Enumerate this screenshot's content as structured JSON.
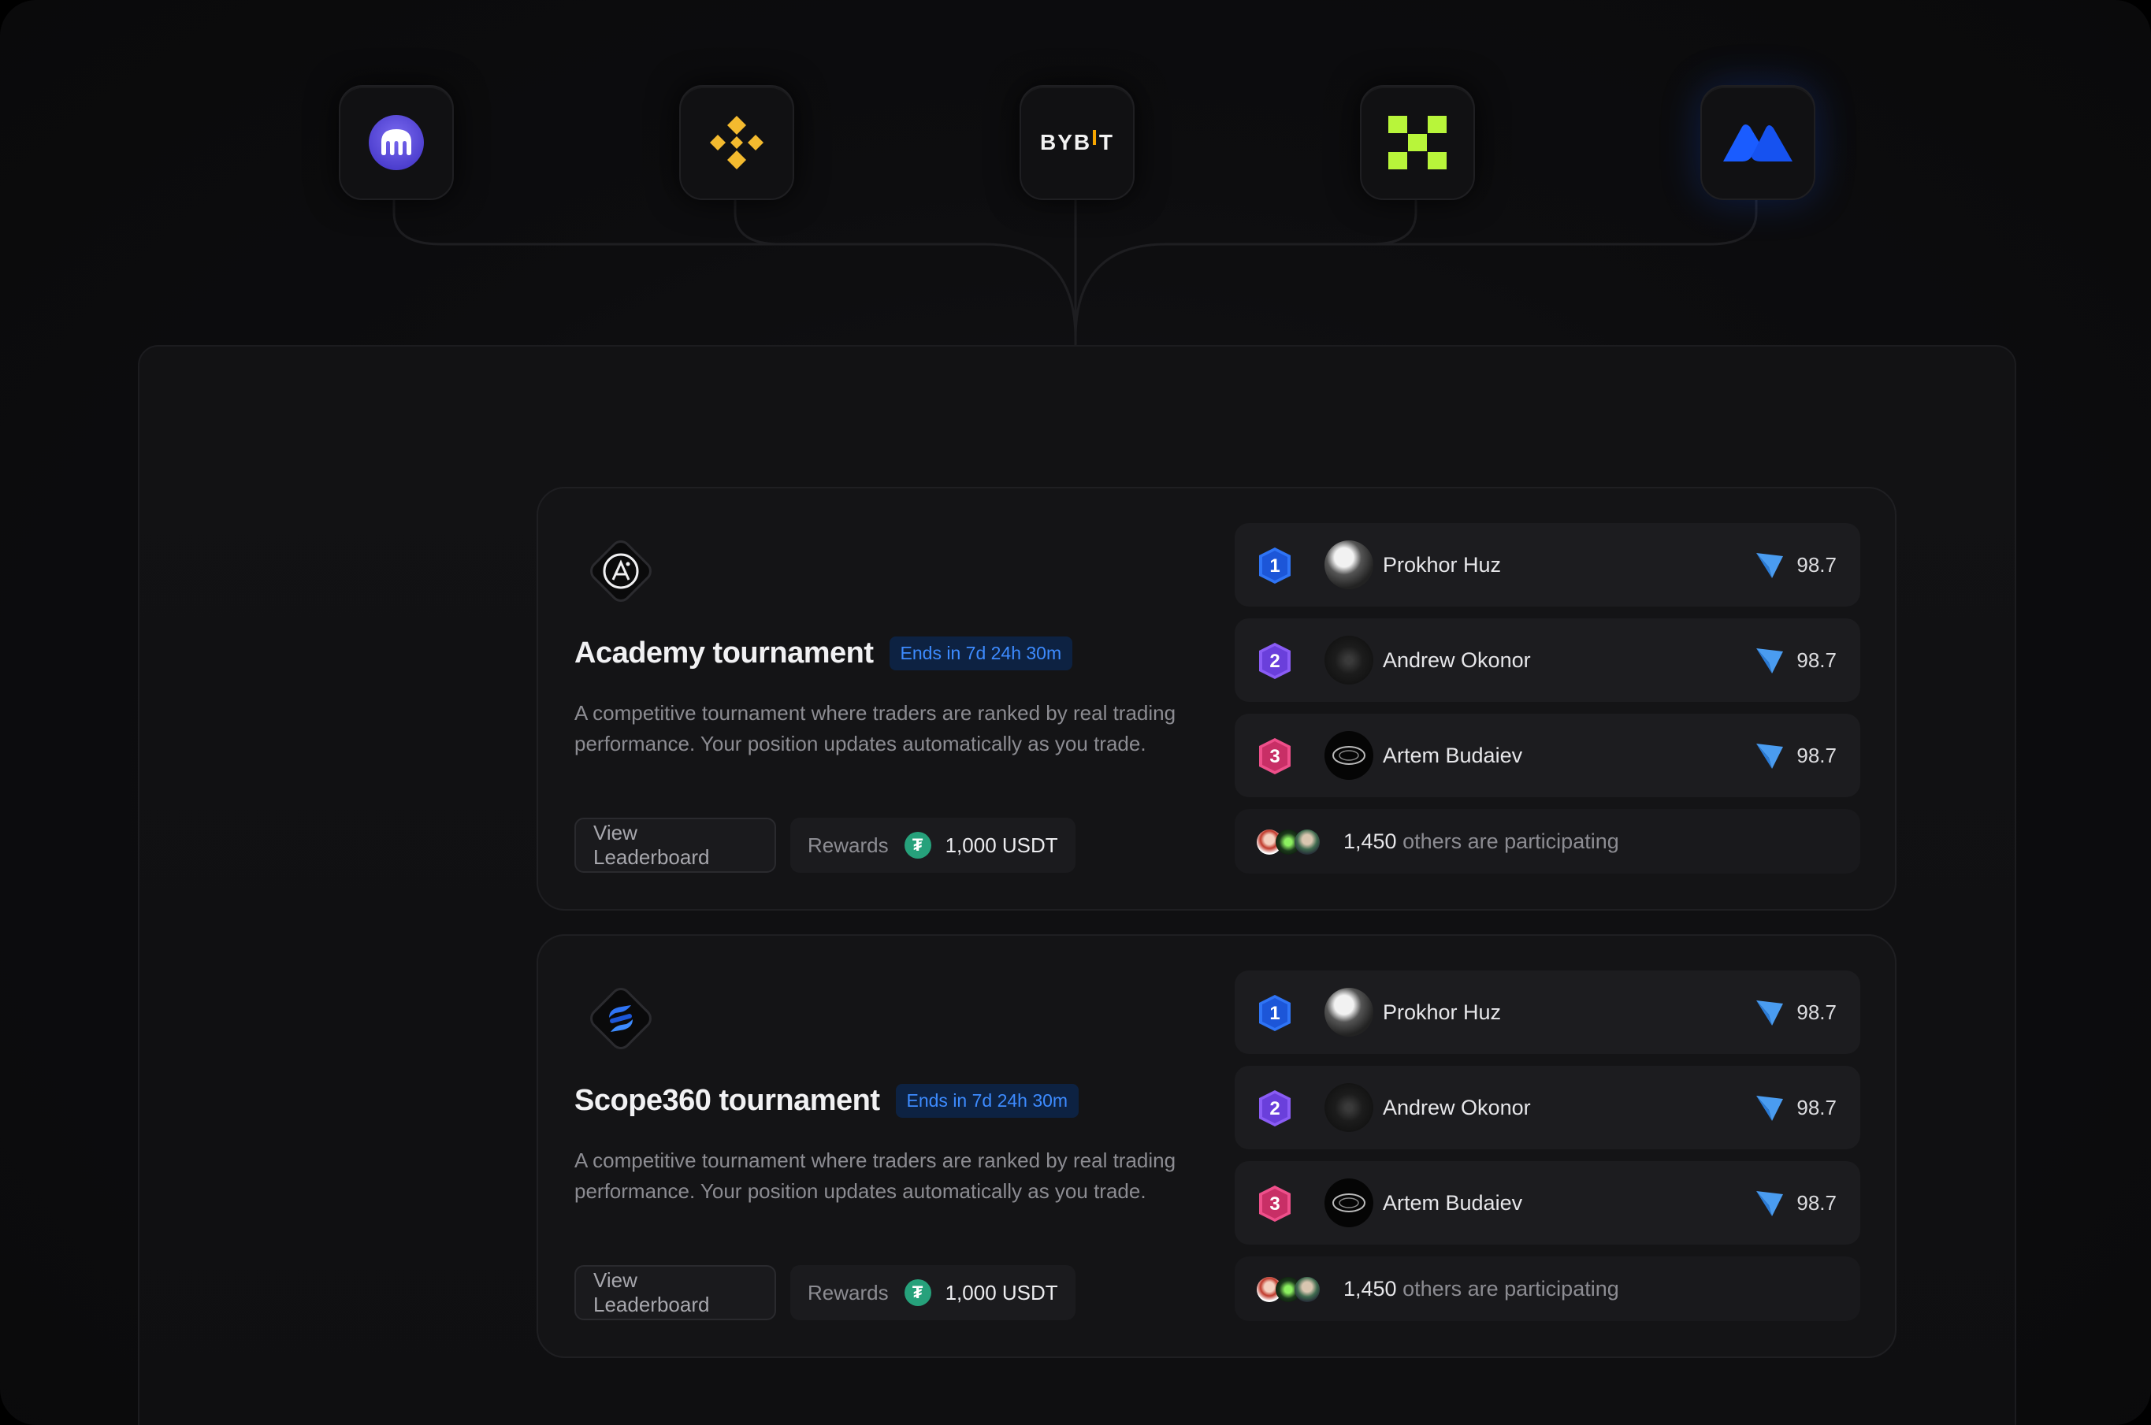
{
  "exchanges": [
    {
      "name": "Kraken",
      "icon": "kraken-logo-icon",
      "color": "#5741d9"
    },
    {
      "name": "Binance",
      "icon": "binance-logo-icon",
      "color": "#f3ba2f"
    },
    {
      "name": "Bybit",
      "icon": "bybit-logo-icon",
      "label": "BYBIT",
      "color": "#f7a600"
    },
    {
      "name": "OKX",
      "icon": "okx-logo-icon",
      "color": "#b8f53a"
    },
    {
      "name": "MEXC",
      "icon": "mexc-logo-icon",
      "color": "#1652f0"
    }
  ],
  "tournaments": [
    {
      "title": "Academy tournament",
      "icon": "academy-logo-icon",
      "ends": "Ends in 7d 24h 30m",
      "description": "A competitive tournament where traders are ranked by real trading performance. Your position updates automatically as you trade.",
      "view_label": "View Leaderboard",
      "rewards_label": "Rewards",
      "rewards_amount": "1,000 USDT",
      "leaders": [
        {
          "rank": "1",
          "name": "Prokhor Huz",
          "score": "98.7"
        },
        {
          "rank": "2",
          "name": "Andrew Okonor",
          "score": "98.7"
        },
        {
          "rank": "3",
          "name": "Artem Budaiev",
          "score": "98.7"
        }
      ],
      "others_count": "1,450",
      "others_text": "others are participating"
    },
    {
      "title": "Scope360 tournament",
      "icon": "scope360-logo-icon",
      "ends": "Ends in 7d 24h 30m",
      "description": "A competitive tournament where traders are ranked by real trading performance. Your position updates automatically as you trade.",
      "view_label": "View Leaderboard",
      "rewards_label": "Rewards",
      "rewards_amount": "1,000 USDT",
      "leaders": [
        {
          "rank": "1",
          "name": "Prokhor Huz",
          "score": "98.7"
        },
        {
          "rank": "2",
          "name": "Andrew Okonor",
          "score": "98.7"
        },
        {
          "rank": "3",
          "name": "Artem Budaiev",
          "score": "98.7"
        }
      ],
      "others_count": "1,450",
      "others_text": "others are participating"
    }
  ],
  "rank_colors": {
    "1": "#2f74f5",
    "2": "#7a4df0",
    "3": "#e0407a"
  },
  "accent": "#3d8bff"
}
